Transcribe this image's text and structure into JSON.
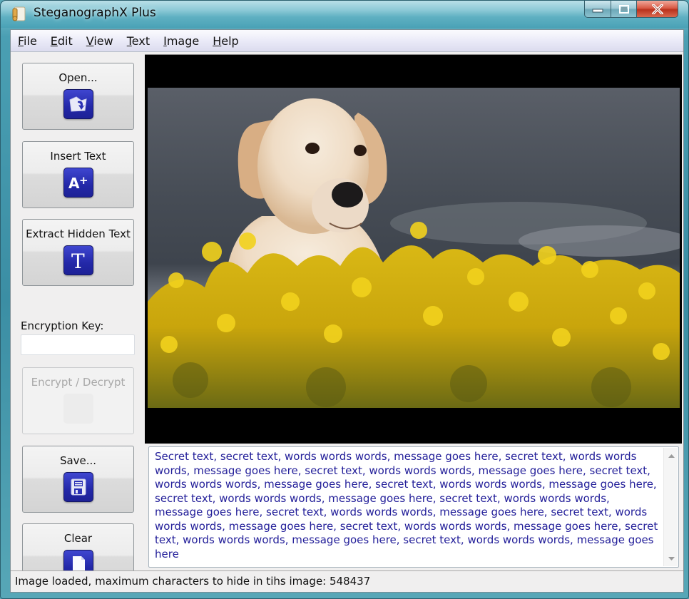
{
  "window": {
    "title": "SteganographX Plus",
    "controls": {
      "minimize": "minimize",
      "maximize": "maximize",
      "close": "close"
    }
  },
  "menu": {
    "items": [
      {
        "label": "File",
        "mnemonic": "F",
        "rest": "ile"
      },
      {
        "label": "Edit",
        "mnemonic": "E",
        "rest": "dit"
      },
      {
        "label": "View",
        "mnemonic": "V",
        "rest": "iew"
      },
      {
        "label": "Text",
        "mnemonic": "T",
        "rest": "ext"
      },
      {
        "label": "Image",
        "mnemonic": "I",
        "rest": "mage"
      },
      {
        "label": "Help",
        "mnemonic": "H",
        "rest": "elp"
      }
    ]
  },
  "sidebar": {
    "buttons": [
      {
        "label": "Open...",
        "icon": "open-folder-icon",
        "enabled": true
      },
      {
        "label": "Insert Text",
        "icon": "insert-text-icon",
        "enabled": true
      },
      {
        "label": "Extract Hidden Text",
        "icon": "extract-text-icon",
        "enabled": true
      },
      {
        "label": "Encrypt / Decrypt",
        "icon": "encrypt-icon",
        "enabled": false
      },
      {
        "label": "Save...",
        "icon": "save-disk-icon",
        "enabled": true
      },
      {
        "label": "Clear",
        "icon": "clear-page-icon",
        "enabled": true
      }
    ],
    "encryption_key": {
      "label": "Encryption Key:",
      "value": "",
      "placeholder": ""
    }
  },
  "image": {
    "description": "Golden retriever dog among yellow rapeseed flowers under a stormy grey sky",
    "colors": {
      "sky": "#4c525b",
      "flowers": "#e4c21a",
      "dog": "#f0dcc4",
      "letterbox": "#000000"
    }
  },
  "hidden_text": {
    "value": "Secret text, secret text, words words words, message goes here, secret text, words words words, message goes here, secret text, words words words, message goes here, secret text, words words words, message goes here, secret text, words words words, message goes here, secret text, words words words, message goes here, secret text, words words words, message goes here, secret text, words words words, message goes here, secret text, words words words, message goes here, secret text, words words words, message goes here, secret text, words words words, message goes here, secret text, words words words, message goes here"
  },
  "status": {
    "text": "Image loaded, maximum characters to hide in tihs image: 548437",
    "max_characters": 548437
  },
  "colors": {
    "accent_icon": "#2328a8",
    "text_blue": "#24209a",
    "close_red": "#d85a45"
  }
}
